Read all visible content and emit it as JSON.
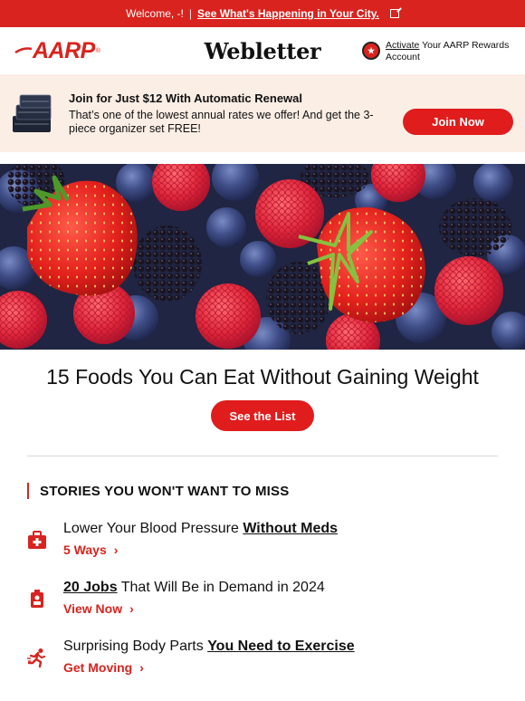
{
  "topbar": {
    "welcome": "Welcome, -!",
    "separator": "|",
    "link": "See What's Happening in Your City."
  },
  "header": {
    "logo": "AARP",
    "logo_mark": "®",
    "title": "Webletter",
    "rewards_link": "Activate",
    "rewards_text": " Your AARP Rewards Account"
  },
  "promo": {
    "title": "Join for Just $12 With Automatic Renewal",
    "body": "That’s one of the lowest annual rates we offer!  And get the 3-piece organizer set FREE!",
    "button": "Join Now"
  },
  "feature": {
    "headline": "15 Foods You Can Eat Without Gaining Weight",
    "button": "See the List"
  },
  "section": {
    "title": "STORIES YOU WON'T WANT TO MISS"
  },
  "stories": [
    {
      "pre": "Lower Your Blood Pressure ",
      "em": "Without Meds",
      "post": "",
      "link": "5 Ways",
      "icon": "first-aid-kit-icon"
    },
    {
      "pre": "",
      "em": "20 Jobs",
      "post": " That Will Be in Demand in 2024",
      "link": "View Now",
      "icon": "id-badge-icon"
    },
    {
      "pre": "Surprising Body Parts ",
      "em": "You Need to Exercise",
      "post": "",
      "link": "Get Moving",
      "icon": "runner-icon"
    }
  ],
  "colors": {
    "brand_red": "#d9231e",
    "button_red": "#e01c1c",
    "promo_bg": "#fbeee5"
  }
}
